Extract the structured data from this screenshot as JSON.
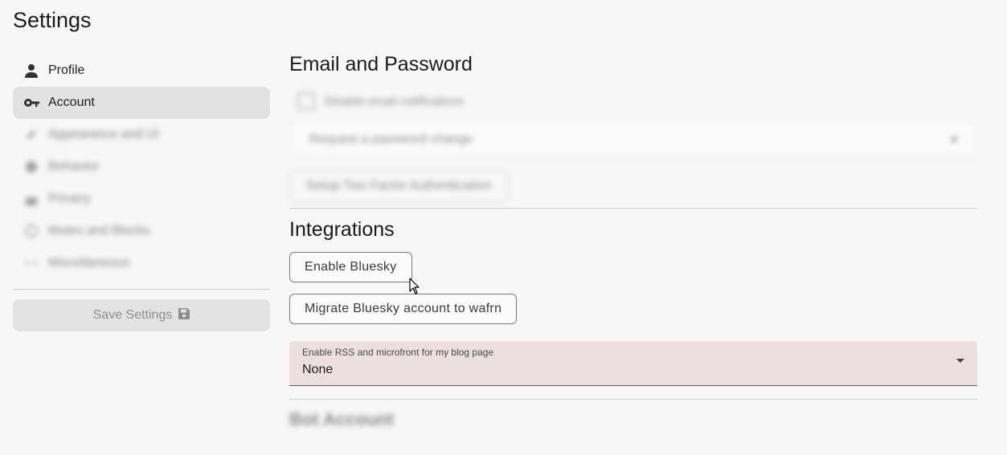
{
  "page": {
    "title": "Settings"
  },
  "sidebar": {
    "items": [
      {
        "label": "Profile",
        "icon": "person-icon",
        "active": false
      },
      {
        "label": "Account",
        "icon": "key-icon",
        "active": true
      },
      {
        "label": "Appearance and UI",
        "icon": "brush-icon",
        "blurred": true
      },
      {
        "label": "Behavior",
        "icon": "gear-icon",
        "blurred": true
      },
      {
        "label": "Privacy",
        "icon": "lock-icon",
        "blurred": true
      },
      {
        "label": "Mutes and Blocks",
        "icon": "block-icon",
        "blurred": true
      },
      {
        "label": "Miscellaneous",
        "icon": "dots-icon",
        "blurred": true
      }
    ],
    "save_label": "Save Settings"
  },
  "email_section": {
    "heading": "Email and Password",
    "checkbox_label": "Disable email notifications",
    "select_value": "Request a password change",
    "twofa_label": "Setup Two Factor Authentication"
  },
  "integrations": {
    "heading": "Integrations",
    "enable_bluesky": "Enable Bluesky",
    "migrate_bluesky": "Migrate Bluesky account to wafrn",
    "rss_label": "Enable RSS and microfront for my blog page",
    "rss_value": "None"
  },
  "bot_section": {
    "heading": "Bot Account"
  },
  "colors": {
    "active_nav": "#e2e2e2",
    "rss_field": "#ecdfe0",
    "page_bg": "#f7f7f7"
  }
}
